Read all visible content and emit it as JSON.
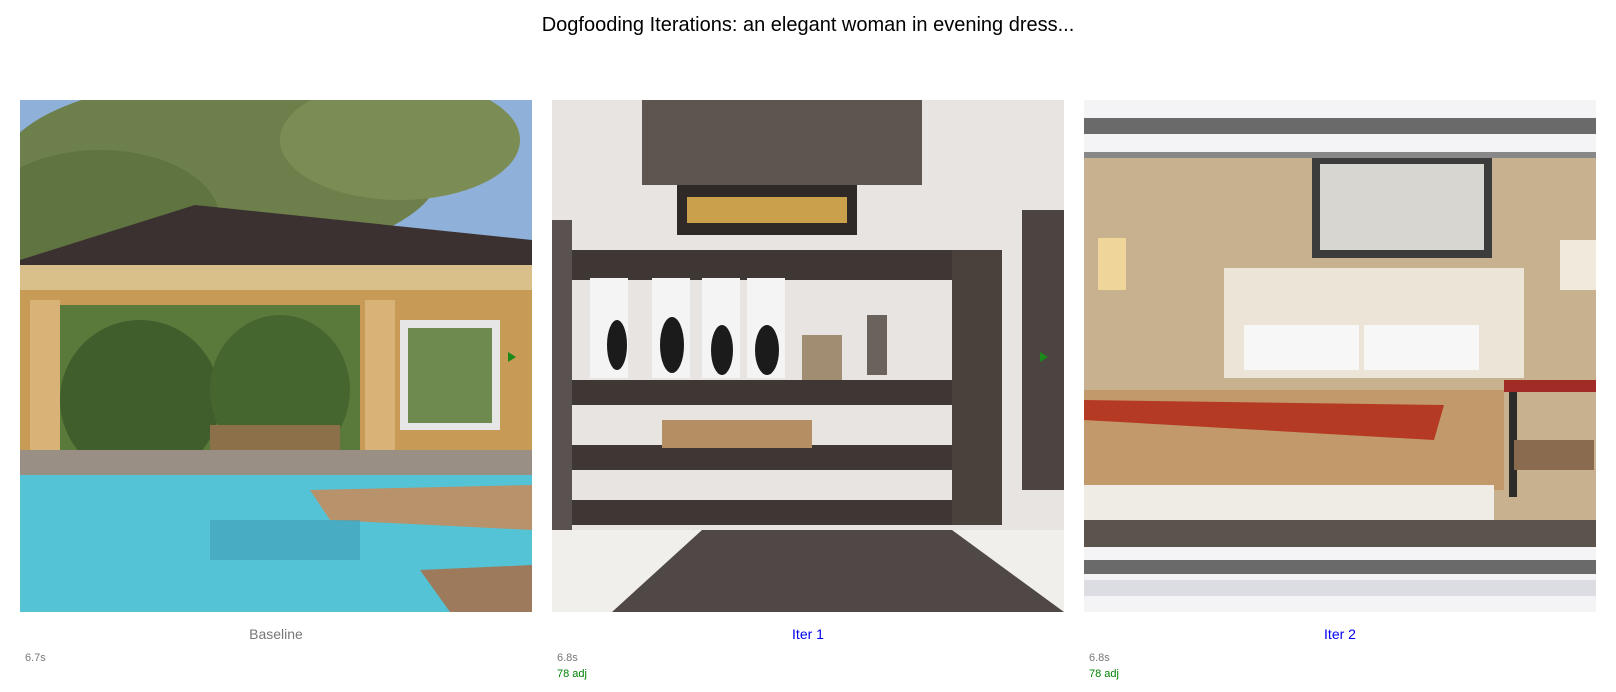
{
  "title": "Dogfooding Iterations: an elegant woman in evening dress...",
  "panels": [
    {
      "label": "Baseline",
      "time": "6.7s",
      "adj": ""
    },
    {
      "label": "Iter 1",
      "time": "6.8s",
      "adj": "78 adj"
    },
    {
      "label": "Iter 2",
      "time": "6.8s",
      "adj": "78 adj"
    }
  ],
  "colors": {
    "muted": "#777777",
    "link": "#0000ee",
    "adj": "#008000"
  }
}
